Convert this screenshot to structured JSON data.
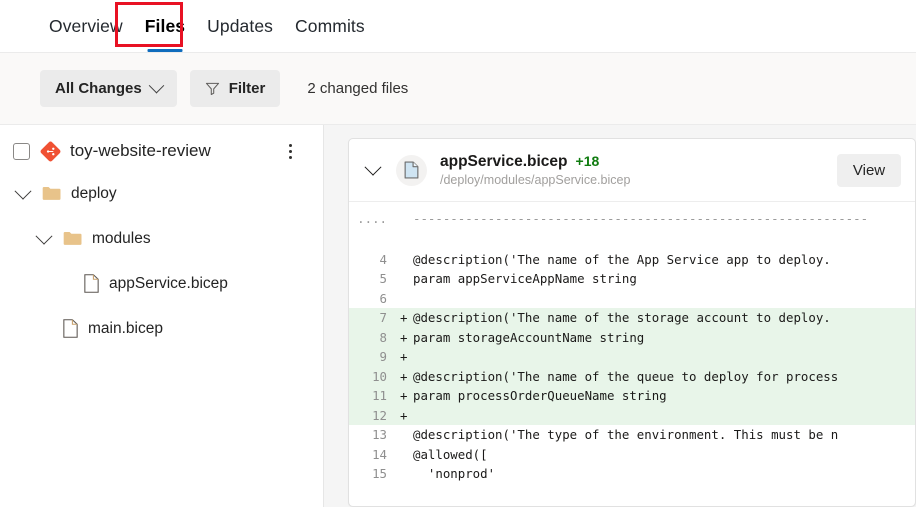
{
  "tabs": [
    {
      "label": "Overview",
      "selected": false
    },
    {
      "label": "Files",
      "selected": true
    },
    {
      "label": "Updates",
      "selected": false
    },
    {
      "label": "Commits",
      "selected": false
    }
  ],
  "toolbar": {
    "all_changes_label": "All Changes",
    "filter_label": "Filter",
    "changed_files_text": "2 changed files"
  },
  "sidebar": {
    "repo_name": "toy-website-review",
    "tree": [
      {
        "label": "deploy",
        "type": "folder",
        "depth": 1,
        "expanded": true
      },
      {
        "label": "modules",
        "type": "folder",
        "depth": 2,
        "expanded": true
      },
      {
        "label": "appService.bicep",
        "type": "file",
        "depth": 3
      },
      {
        "label": "main.bicep",
        "type": "file",
        "depth": 2
      }
    ]
  },
  "diff": {
    "filename": "appService.bicep",
    "additions": "+18",
    "path": "/deploy/modules/appService.bicep",
    "view_label": "View",
    "hunk_left": "....",
    "hunk_right": "-------------------------------------------------------------",
    "lines": [
      {
        "num": "4",
        "sign": "",
        "text": "@description('The name of the App Service app to deploy.",
        "added": false
      },
      {
        "num": "5",
        "sign": "",
        "text": "param appServiceAppName string",
        "added": false
      },
      {
        "num": "6",
        "sign": "",
        "text": "",
        "added": false
      },
      {
        "num": "7",
        "sign": "+",
        "text": "@description('The name of the storage account to deploy.",
        "added": true
      },
      {
        "num": "8",
        "sign": "+",
        "text": "param storageAccountName string",
        "added": true
      },
      {
        "num": "9",
        "sign": "+",
        "text": "",
        "added": true
      },
      {
        "num": "10",
        "sign": "+",
        "text": "@description('The name of the queue to deploy for process",
        "added": true
      },
      {
        "num": "11",
        "sign": "+",
        "text": "param processOrderQueueName string",
        "added": true
      },
      {
        "num": "12",
        "sign": "+",
        "text": "",
        "added": true
      },
      {
        "num": "13",
        "sign": "",
        "text": "@description('The type of the environment. This must be n",
        "added": false
      },
      {
        "num": "14",
        "sign": "",
        "text": "@allowed([",
        "added": false
      },
      {
        "num": "15",
        "sign": "",
        "text": "  'nonprod'",
        "added": false
      }
    ]
  },
  "colors": {
    "accent": "#0f6cbd",
    "annotation": "#e81123",
    "additions": "#107c10",
    "diff_add_bg": "#e8f5e9",
    "repo_icon": "#f05133",
    "folder": "#e8c38a"
  }
}
